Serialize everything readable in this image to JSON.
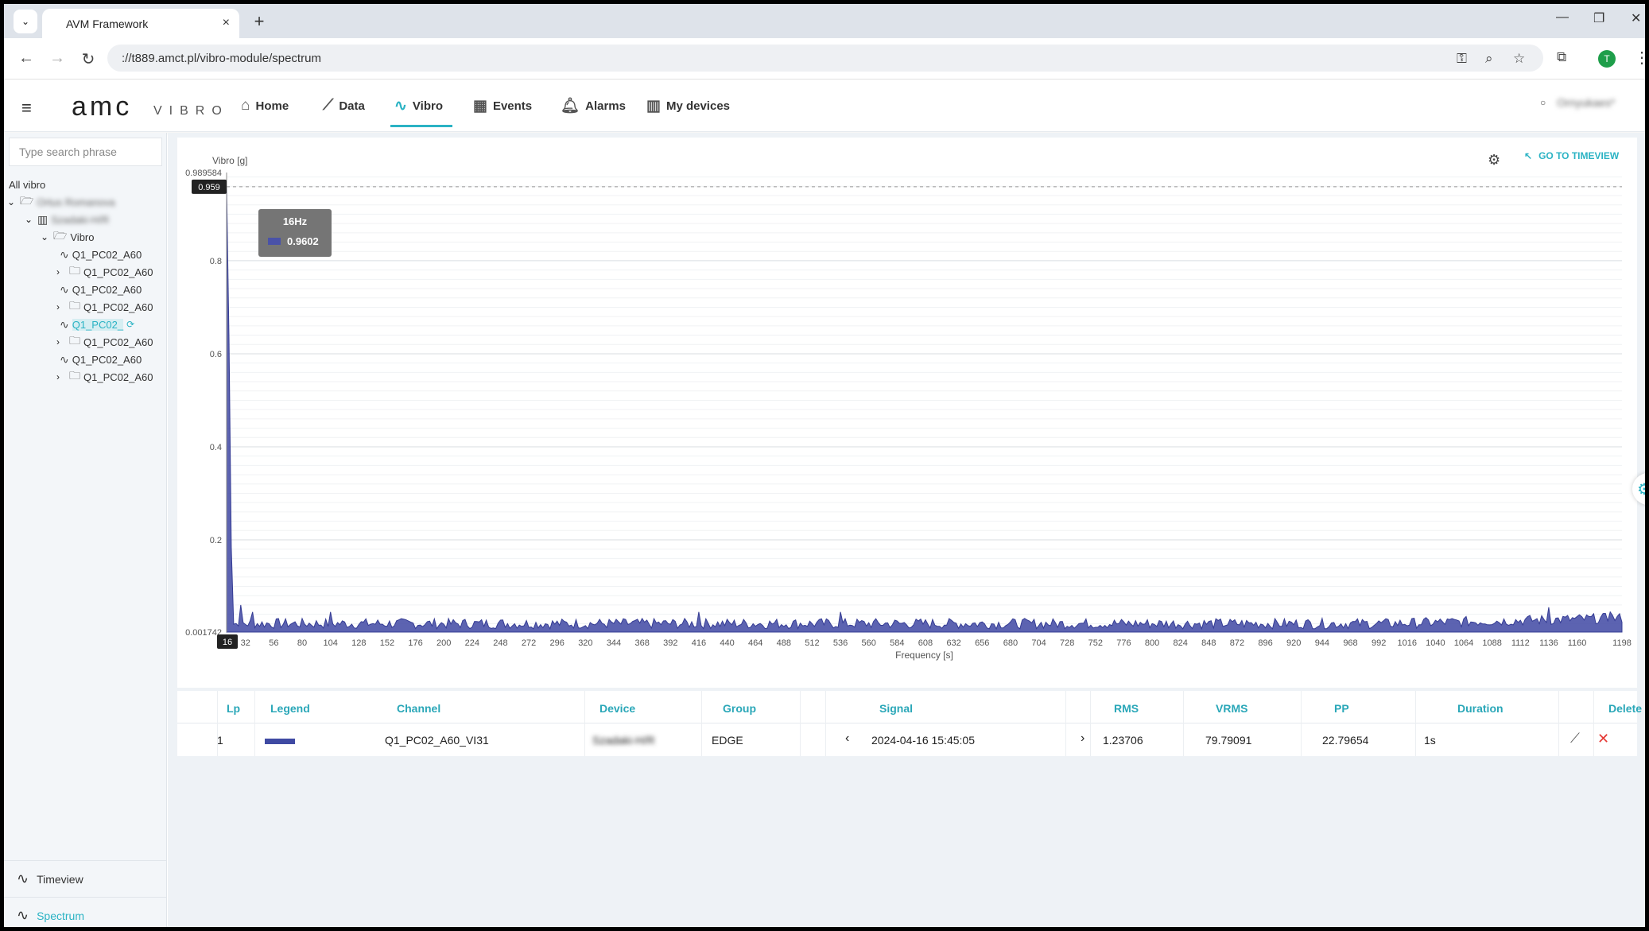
{
  "browser": {
    "tab_title": "AVM Framework",
    "tab_close": "×",
    "new_tab": "+",
    "url": "://t889.amct.pl/vibro-module/spectrum",
    "profile_initial": "T"
  },
  "header": {
    "logo": "amc",
    "logo_sub": "VIBRO",
    "nav": [
      {
        "label": "Home",
        "icon": "home-icon"
      },
      {
        "label": "Data",
        "icon": "chart-line-icon"
      },
      {
        "label": "Vibro",
        "icon": "wave-icon"
      },
      {
        "label": "Events",
        "icon": "calendar-icon"
      },
      {
        "label": "Alarms",
        "icon": "bell-icon"
      },
      {
        "label": "My devices",
        "icon": "devices-icon"
      }
    ],
    "active_nav": "Vibro",
    "user": "Ornyukaes*"
  },
  "sidebar": {
    "search_placeholder": "Type search phrase",
    "tree_root": "All vibro",
    "tree": [
      {
        "label": "Ortus Romanova",
        "blurred": true
      },
      {
        "label": "Szadaki-H/R",
        "blurred": true
      },
      {
        "label": "Vibro"
      },
      {
        "label": "Q1_PC02_A60"
      },
      {
        "label": "Q1_PC02_A60"
      },
      {
        "label": "Q1_PC02_A60"
      },
      {
        "label": "Q1_PC02_A60"
      },
      {
        "label": "Q1_PC02_"
      },
      {
        "label": "Q1_PC02_A60"
      },
      {
        "label": "Q1_PC02_A60"
      },
      {
        "label": "Q1_PC02_A60"
      }
    ],
    "footer": [
      {
        "label": "Timeview",
        "selected": false
      },
      {
        "label": "Spectrum",
        "selected": true
      }
    ]
  },
  "chart_toolbar": {
    "goto_label": "GO TO TIMEVIEW"
  },
  "chart_data": {
    "type": "area",
    "ylabel": "Vibro [g]",
    "xlabel": "Frequency [s]",
    "ylim": [
      0.001742,
      0.989584
    ],
    "y_top_label": "0.989584",
    "y_bottom_label": "0.001742",
    "y_ticks": [
      0.2,
      0.4,
      0.6,
      0.8
    ],
    "y_tick_labels": [
      "0.2",
      "0.4",
      "0.6",
      "0.8"
    ],
    "x_range": [
      16,
      1198
    ],
    "x_ticks": [
      32,
      56,
      80,
      104,
      128,
      152,
      176,
      200,
      224,
      248,
      272,
      296,
      320,
      344,
      368,
      392,
      416,
      440,
      464,
      488,
      512,
      536,
      560,
      584,
      608,
      632,
      656,
      680,
      704,
      728,
      752,
      776,
      800,
      824,
      848,
      872,
      896,
      920,
      944,
      968,
      992,
      1016,
      1040,
      1064,
      1088,
      1112,
      1136,
      1160,
      1198
    ],
    "x_cursor_label": "16",
    "y_cursor_label": "0.959",
    "tooltip": {
      "title": "16Hz",
      "value": "0.9602"
    },
    "series": [
      {
        "color": "#4a52a8",
        "peaks": [
          {
            "x": 16,
            "y": 0.9602
          },
          {
            "x": 14,
            "y": 0.06
          },
          {
            "x": 28,
            "y": 0.06
          },
          {
            "x": 38,
            "y": 0.045
          },
          {
            "x": 104,
            "y": 0.045
          },
          {
            "x": 416,
            "y": 0.045
          },
          {
            "x": 536,
            "y": 0.045
          },
          {
            "x": 1136,
            "y": 0.055
          },
          {
            "x": 1188,
            "y": 0.045
          }
        ],
        "baseline": 0.025
      }
    ],
    "grid": true
  },
  "table": {
    "headers": [
      "Lp",
      "Legend",
      "Channel",
      "Device",
      "Group",
      "Signal",
      "RMS",
      "VRMS",
      "PP",
      "Duration",
      "Delete"
    ],
    "rows": [
      {
        "lp": "1",
        "channel": "Q1_PC02_A60_VI31",
        "device": "Szadaki-H/R",
        "group": "EDGE",
        "prev": "‹",
        "signal": "2024-04-16 15:45:05",
        "next": "›",
        "rms": "1.23706",
        "vrms": "79.79091",
        "pp": "22.79654",
        "duration": "1s"
      }
    ]
  }
}
